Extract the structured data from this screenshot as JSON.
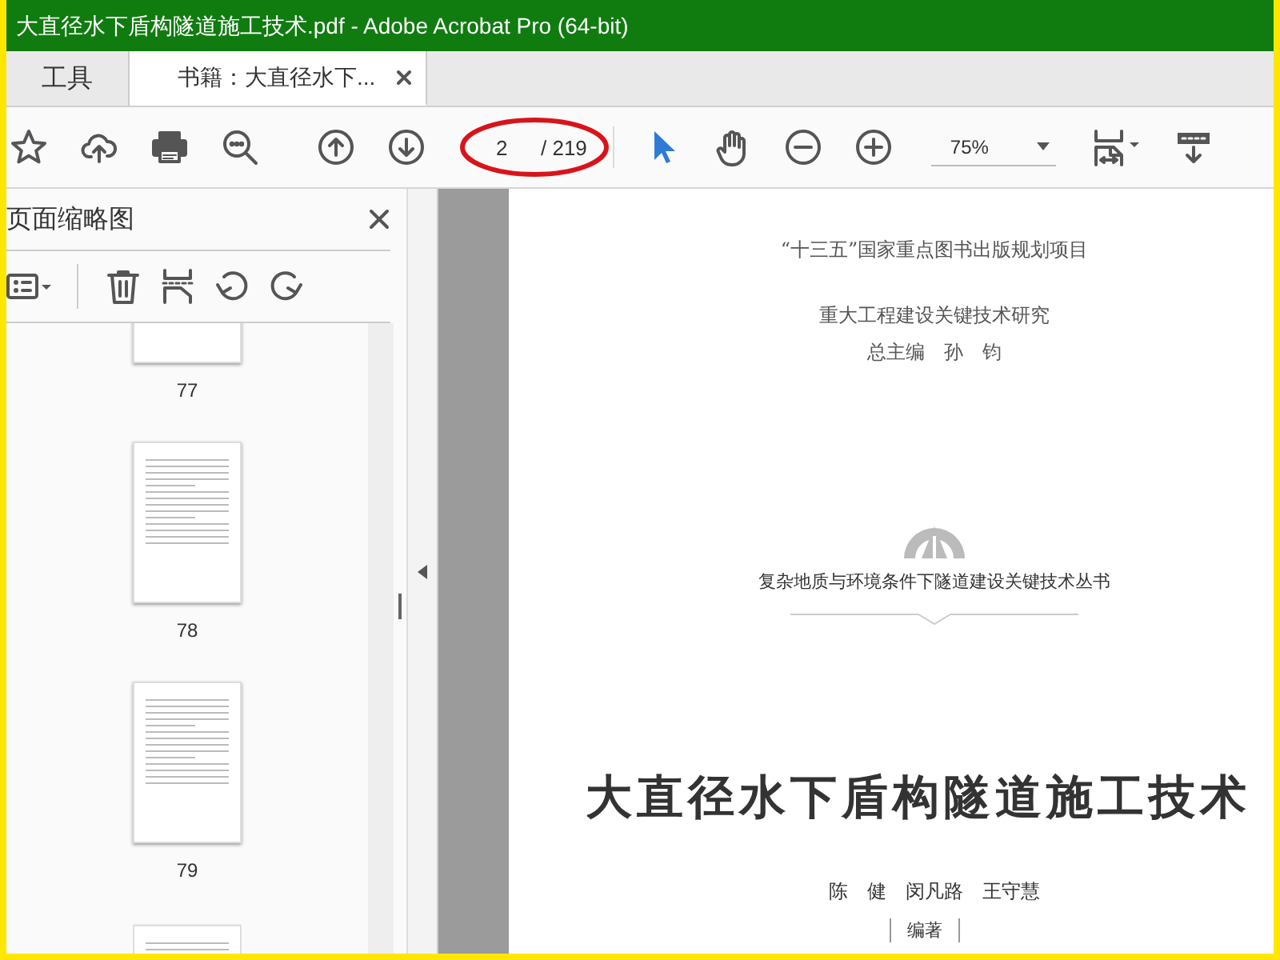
{
  "window": {
    "title": "大直径水下盾构隧道施工技术.pdf - Adobe Acrobat Pro (64-bit)"
  },
  "tabs": [
    {
      "label": "工具",
      "selected": false,
      "closable": false
    },
    {
      "label": "书籍：大直径水下...",
      "selected": true,
      "closable": true
    }
  ],
  "toolbar": {
    "page_number": "2",
    "page_total": "/ 219",
    "page_circled": true,
    "zoom": "75%"
  },
  "sidebar": {
    "title": "页面缩略图",
    "thumbnails": [
      {
        "kind": "tail",
        "label": "77"
      },
      {
        "kind": "full",
        "label": "78"
      },
      {
        "kind": "full",
        "label": "79"
      },
      {
        "kind": "head"
      }
    ]
  },
  "page": {
    "program": "“十三五”国家重点图书出版规划项目",
    "series_research": "重大工程建设关键技术研究",
    "chief_editor": "总主编　孙　钧",
    "series_book": "复杂地质与环境条件下隧道建设关键技术丛书",
    "book_title": "大直径水下盾构隧道施工技术",
    "authors": "陈　健　闵凡路　王守慧",
    "role": "编著"
  }
}
